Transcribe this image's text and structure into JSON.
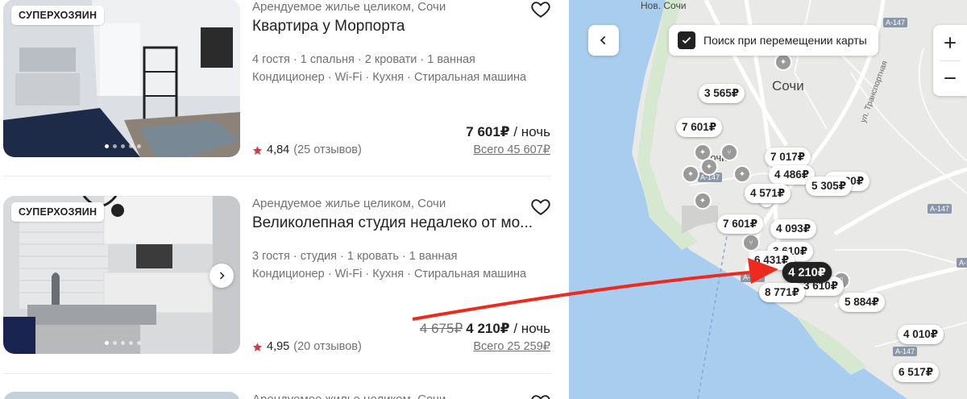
{
  "listings": [
    {
      "badge": "СУПЕРХОЗЯИН",
      "subtitle": "Арендуемое жилье целиком, Сочи",
      "title": "Квартира у Морпорта",
      "details": "4 гостя · 1 спальня · 2 кровати · 1 ванная",
      "amenities": "Кондиционер · Wi-Fi · Кухня · Стиральная машина",
      "rating": "4,84",
      "reviews": "(25 отзывов)",
      "price": "7 601₽",
      "per_night": " / ночь",
      "total": "Всего 45 607₽"
    },
    {
      "badge": "СУПЕРХОЗЯИН",
      "subtitle": "Арендуемое жилье целиком, Сочи",
      "title": "Великолепная студия недалеко от мо...",
      "details": "3 гостя · студия · 1 кровать · 1 ванная",
      "amenities": "Кондиционер · Wi-Fi · Кухня · Стиральная машина",
      "rating": "4,95",
      "reviews": "(20 отзывов)",
      "old_price": "4 675₽",
      "price": "4 210₽",
      "per_night": " / ночь",
      "total": "Всего 25 259₽"
    },
    {
      "subtitle": "Арендуемое жилье целиком, Сочи"
    }
  ],
  "map": {
    "search_toggle_label": "Поиск при перемещении карты",
    "search_toggle_checked": true,
    "city_label": "Сочи",
    "district_label": "Нов. Сочи",
    "center_label": "Сочи",
    "roads": [
      "А-147",
      "А-147",
      "А-147",
      "А-147",
      "А-147",
      "А-1"
    ],
    "street_label": "ул. Транспортная",
    "pins": [
      "3 565₽",
      "7 601₽",
      "7 017₽",
      "4 486₽",
      "5 305₽",
      "4 571₽",
      "7 601₽",
      "4 093₽",
      "6 431₽",
      "4 210₽",
      "8 771₽",
      "5 884₽",
      "4 010₽",
      "6 517₽",
      "4 180₽",
      "3 610₽",
      "8"
    ],
    "active_pin": "4 210₽",
    "colors": {
      "water": "#a9cdee",
      "land": "#e9e9e7",
      "road": "#ffffff",
      "green": "#d6e8cf",
      "arrow": "#ee2a1e"
    }
  }
}
